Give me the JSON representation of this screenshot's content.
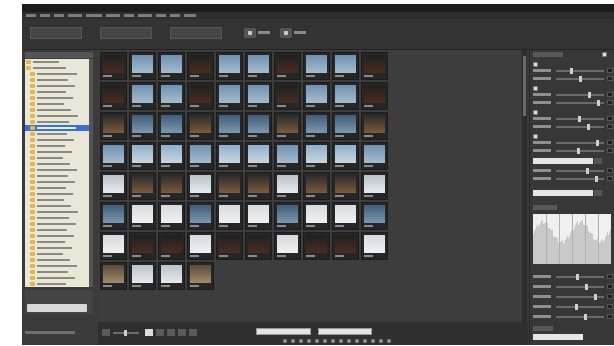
{
  "window": {
    "title": ""
  },
  "colors": {
    "folder": "#e2b64a",
    "selection": "#3b6fd8",
    "canvas": "#3a3a3a",
    "tree_bg": "#e9e7d8"
  },
  "toolbar": {
    "tabs": [
      "",
      "",
      ""
    ]
  },
  "icons": [
    "rotate-icon",
    "grid-view-icon",
    "list-view-icon",
    "single-view-icon",
    "folder-icon",
    "histogram-icon",
    "scrollbar-icon"
  ],
  "bottom": {
    "sort_value": "",
    "filter_value": ""
  },
  "right_panel": {
    "title": ""
  }
}
